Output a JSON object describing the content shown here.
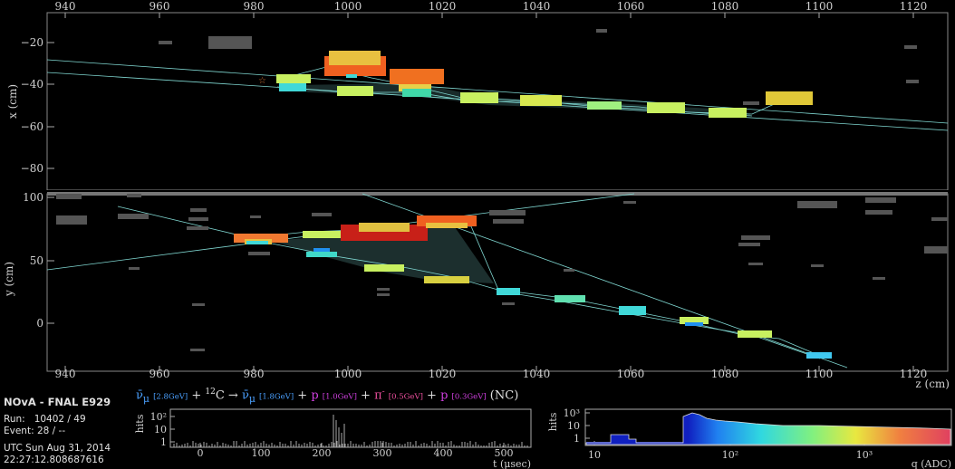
{
  "experiment": {
    "title": "NOvA - FNAL E929",
    "run_label": "Run:",
    "run_value": "10402 / 49",
    "event_label": "Event:",
    "event_value": "28 / --",
    "date": "UTC Sun Aug 31, 2014",
    "time": "22:27:12.808687616"
  },
  "reaction": {
    "nu1": "ν̄",
    "nu1_sub": "μ",
    "e1": "[2.8GeV]",
    "plus1": " + ",
    "c_sup": "12",
    "c": "C → ",
    "nu2": "ν̄",
    "nu2_sub": "μ",
    "e2": "[1.8GeV]",
    "plus2": " + ",
    "p1": "p",
    "e3": "[1.0GeV]",
    "plus3": " + ",
    "pi": "π",
    "pi_sup": "-",
    "e4": "[0.5GeV]",
    "plus4": " + ",
    "p2": "p",
    "e5": "[0.3GeV]",
    "nc": " (NC)"
  },
  "xz_view": {
    "z_ticks": [
      "940",
      "960",
      "980",
      "1000",
      "1020",
      "1040",
      "1060",
      "1080",
      "1100",
      "1120"
    ],
    "x_ticks": [
      "−20",
      "−40",
      "−60",
      "−80"
    ],
    "x_label": "x (cm)"
  },
  "yz_view": {
    "z_ticks": [
      "940",
      "960",
      "980",
      "1000",
      "1020",
      "1040",
      "1060",
      "1080",
      "1100",
      "1120"
    ],
    "y_ticks": [
      "100",
      "50",
      "0"
    ],
    "y_label": "y (cm)",
    "z_label": "z (cm)"
  },
  "time_hist": {
    "y_label": "hits",
    "y_ticks": [
      "10²",
      "10",
      "1"
    ],
    "x_ticks": [
      "0",
      "100",
      "200",
      "300",
      "400",
      "500"
    ],
    "x_label": "t (μsec)"
  },
  "charge_hist": {
    "y_label": "hits",
    "y_ticks": [
      "10³",
      "10",
      "1"
    ],
    "x_ticks": [
      "10",
      "10²",
      "10³"
    ],
    "x_label": "q (ADC)"
  },
  "colors": {
    "background": "#000000",
    "noise_hit": "#555555",
    "track_line": "#7fd6d0",
    "hit_cyan": "#40d8d8",
    "hit_green": "#c8f060",
    "hit_yellow": "#e8d048",
    "hit_orange": "#f08020",
    "hit_red": "#c82018"
  }
}
